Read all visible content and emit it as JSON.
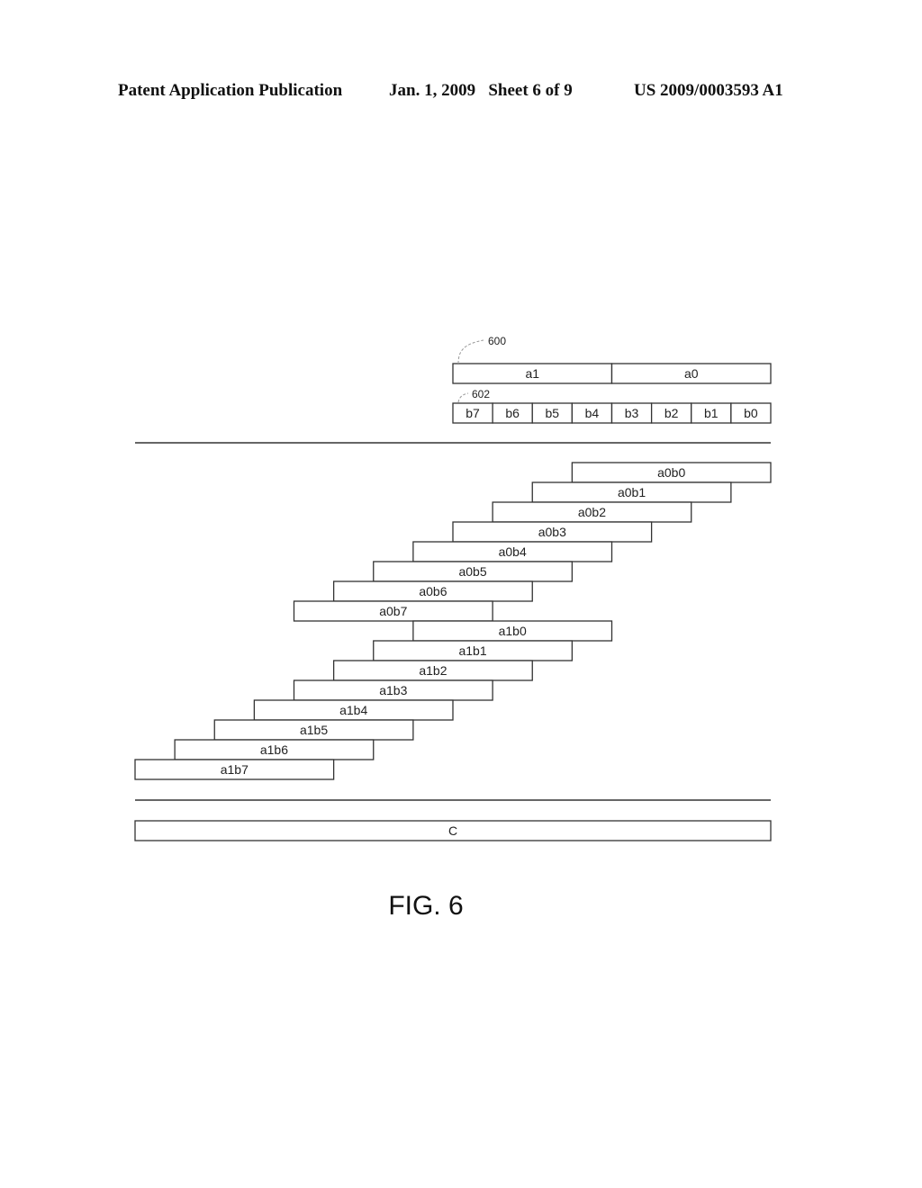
{
  "header": {
    "left": "Patent Application Publication",
    "date_sheet": "Jan. 1, 2009   Sheet 6 of 9",
    "number": "US 2009/0003593 A1"
  },
  "diagram": {
    "operand_a": {
      "ref": "600",
      "words": [
        "a1",
        "a0"
      ]
    },
    "operand_b": {
      "ref": "602",
      "bits": [
        "b7",
        "b6",
        "b5",
        "b4",
        "b3",
        "b2",
        "b1",
        "b0"
      ]
    },
    "partial_products": [
      {
        "label": "a0b0",
        "a_index": 0,
        "b_index": 0
      },
      {
        "label": "a0b1",
        "a_index": 0,
        "b_index": 1
      },
      {
        "label": "a0b2",
        "a_index": 0,
        "b_index": 2
      },
      {
        "label": "a0b3",
        "a_index": 0,
        "b_index": 3
      },
      {
        "label": "a0b4",
        "a_index": 0,
        "b_index": 4
      },
      {
        "label": "a0b5",
        "a_index": 0,
        "b_index": 5
      },
      {
        "label": "a0b6",
        "a_index": 0,
        "b_index": 6
      },
      {
        "label": "a0b7",
        "a_index": 0,
        "b_index": 7
      },
      {
        "label": "a1b0",
        "a_index": 1,
        "b_index": 0
      },
      {
        "label": "a1b1",
        "a_index": 1,
        "b_index": 1
      },
      {
        "label": "a1b2",
        "a_index": 1,
        "b_index": 2
      },
      {
        "label": "a1b3",
        "a_index": 1,
        "b_index": 3
      },
      {
        "label": "a1b4",
        "a_index": 1,
        "b_index": 4
      },
      {
        "label": "a1b5",
        "a_index": 1,
        "b_index": 5
      },
      {
        "label": "a1b6",
        "a_index": 1,
        "b_index": 6
      },
      {
        "label": "a1b7",
        "a_index": 1,
        "b_index": 7
      }
    ],
    "result": "C"
  },
  "figure_label": "FIG. 6"
}
